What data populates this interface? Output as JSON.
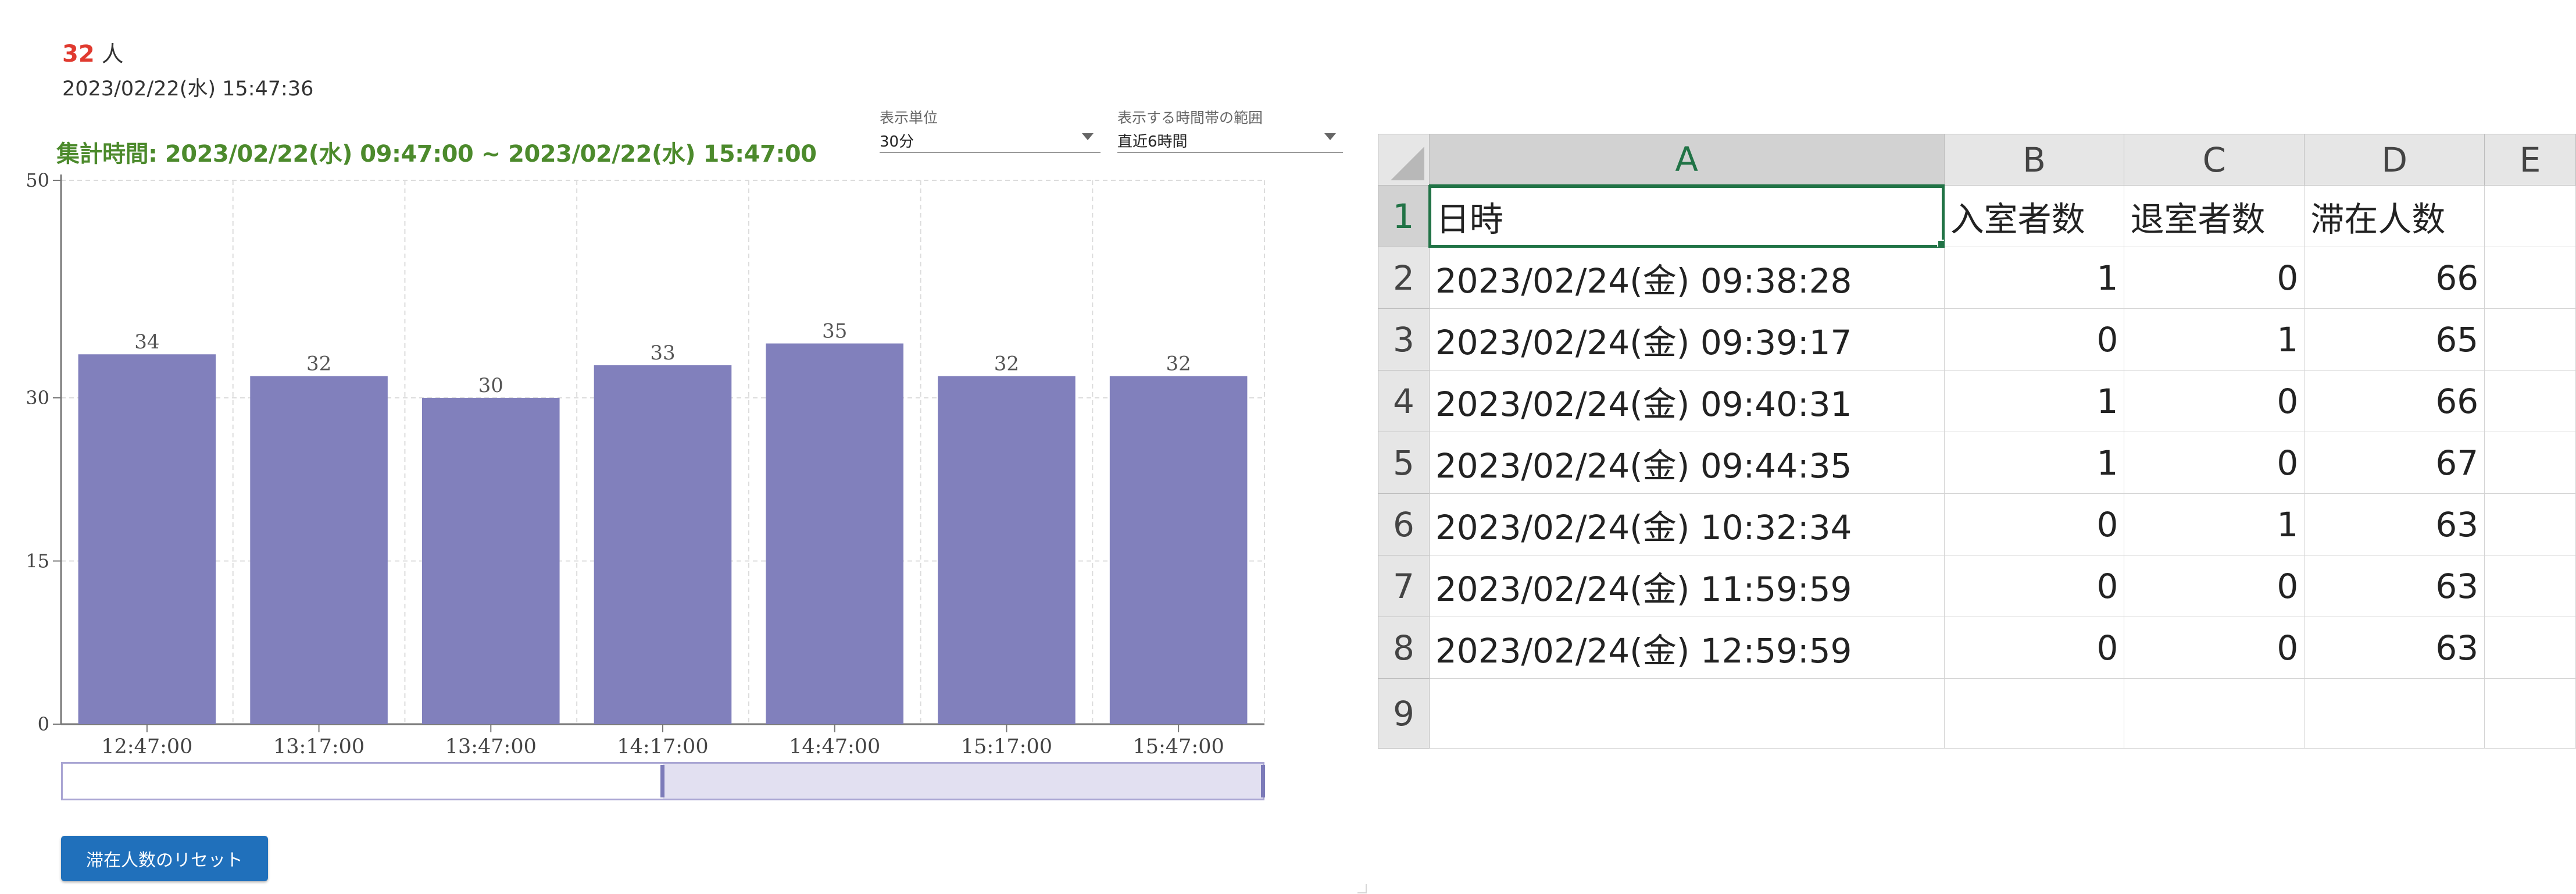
{
  "summary": {
    "count": "32",
    "count_unit": "人",
    "timestamp": "2023/02/22(水) 15:47:36",
    "period": "集計時間: 2023/02/22(水) 09:47:00 ~ 2023/02/22(水) 15:47:00"
  },
  "controls": {
    "unit_label": "表示単位",
    "unit_value": "30分",
    "range_label": "表示する時間帯の範囲",
    "range_value": "直近6時間",
    "reset_label": "滞在人数のリセット"
  },
  "chart_data": {
    "type": "bar",
    "categories": [
      "12:47:00",
      "13:17:00",
      "13:47:00",
      "14:17:00",
      "14:47:00",
      "15:17:00",
      "15:47:00"
    ],
    "values": [
      34,
      32,
      30,
      33,
      35,
      32,
      32
    ],
    "data_labels": [
      "34",
      "32",
      "30",
      "33",
      "35",
      "32",
      "32"
    ],
    "yticks": [
      "0",
      "15",
      "30",
      "50"
    ],
    "ytick_values": [
      0,
      15,
      30,
      50
    ],
    "ylim": [
      0,
      50
    ],
    "grid": true,
    "bar_color": "#8180bc",
    "slider_selection": [
      0.5,
      1.0
    ]
  },
  "spreadsheet": {
    "columns": [
      "A",
      "B",
      "C",
      "D",
      "E"
    ],
    "rows": [
      {
        "n": "1",
        "cells": [
          "日時",
          "入室者数",
          "退室者数",
          "滞在人数"
        ]
      },
      {
        "n": "2",
        "cells": [
          "2023/02/24(金) 09:38:28",
          "1",
          "0",
          "66"
        ]
      },
      {
        "n": "3",
        "cells": [
          "2023/02/24(金) 09:39:17",
          "0",
          "1",
          "65"
        ]
      },
      {
        "n": "4",
        "cells": [
          "2023/02/24(金) 09:40:31",
          "1",
          "0",
          "66"
        ]
      },
      {
        "n": "5",
        "cells": [
          "2023/02/24(金) 09:44:35",
          "1",
          "0",
          "67"
        ]
      },
      {
        "n": "6",
        "cells": [
          "2023/02/24(金) 10:32:34",
          "0",
          "1",
          "63"
        ]
      },
      {
        "n": "7",
        "cells": [
          "2023/02/24(金) 11:59:59",
          "0",
          "0",
          "63"
        ]
      },
      {
        "n": "8",
        "cells": [
          "2023/02/24(金) 12:59:59",
          "0",
          "0",
          "63"
        ]
      },
      {
        "n": "9",
        "cells": [
          "",
          "",
          "",
          ""
        ]
      }
    ],
    "active_cell": "A1",
    "accent_color": "#217346"
  }
}
